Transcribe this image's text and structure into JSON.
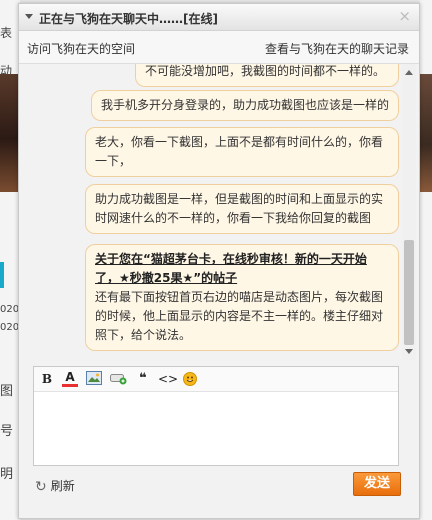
{
  "background": {
    "fragments": [
      "表",
      "动",
      "020",
      "020",
      "图",
      "号",
      "明"
    ]
  },
  "window": {
    "title": "正在与飞狗在天聊天中……[在线]",
    "close_glyph": "×"
  },
  "nav": {
    "visit_space": "访问飞狗在天的空间",
    "view_history": "查看与飞狗在天的聊天记录"
  },
  "messages": [
    {
      "text": "不可能没增加吧，我截图的时间都不一样的。"
    },
    {
      "text": "我手机多开分身登录的，助力成功截图也应该是一样的"
    },
    {
      "text": "老大，你看一下截图，上面不是都有时间什么的，你看一下，"
    },
    {
      "text": "助力成功截图是一样，但是截图的时间和上面显示的实时网速什么的不一样的，你看一下我给你回复的截图"
    },
    {
      "link_text": "关于您在“猫超茅台卡，在线秒审核！新的一天开始了，★秒撤25果★”的帖子",
      "text": "还有最下面按钮首页右边的喵店是动态图片，每次截图的时候，他上面显示的内容是不主一样的。楼主仔细对照下，给个说法。"
    }
  ],
  "toolbar": {
    "bold": "B",
    "color": "A",
    "quote": "❝",
    "code": "<>"
  },
  "editor": {
    "value": "",
    "placeholder": ""
  },
  "footer": {
    "refresh_label": "刷新",
    "send_label": "发送"
  }
}
